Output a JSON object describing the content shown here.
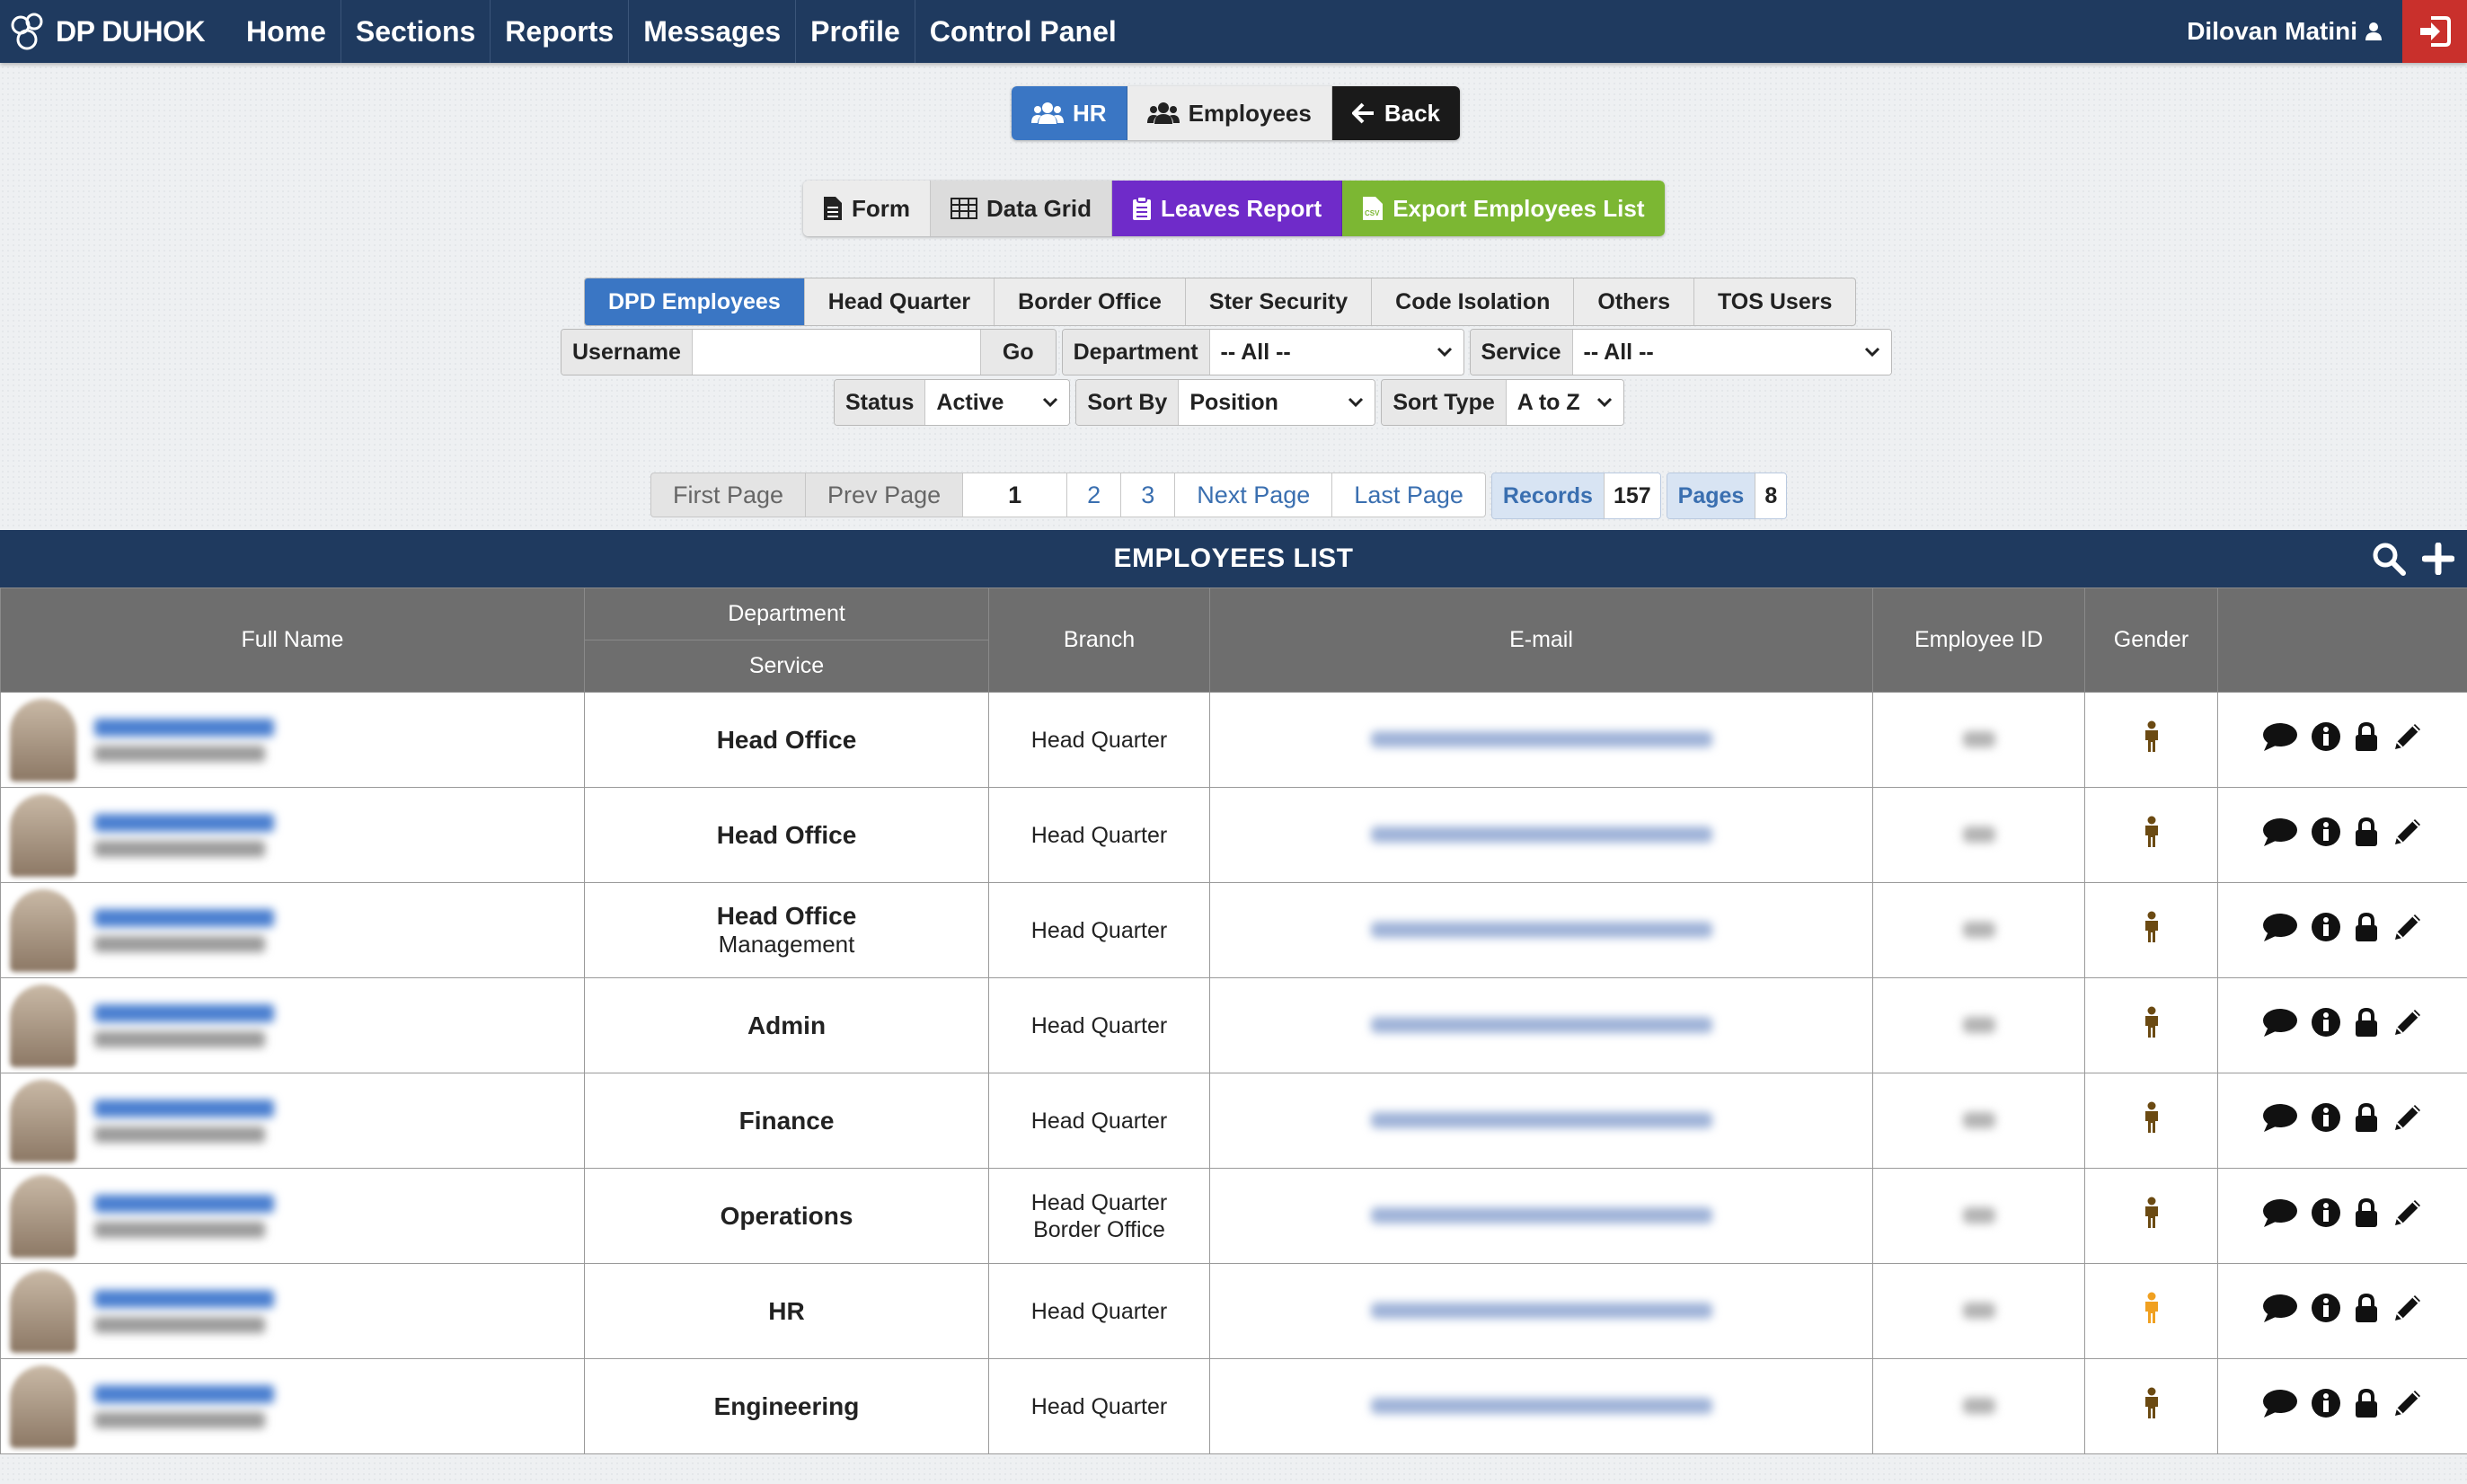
{
  "navbar": {
    "brand": "DP DUHOK",
    "items": [
      "Home",
      "Sections",
      "Reports",
      "Messages",
      "Profile",
      "Control Panel"
    ],
    "user": "Dilovan Matini"
  },
  "top_buttons": {
    "hr": "HR",
    "employees": "Employees",
    "back": "Back"
  },
  "view_buttons": {
    "form": "Form",
    "data_grid": "Data Grid",
    "leaves_report": "Leaves Report",
    "export": "Export Employees List"
  },
  "tabs": [
    "DPD Employees",
    "Head Quarter",
    "Border Office",
    "Ster Security",
    "Code Isolation",
    "Others",
    "TOS Users"
  ],
  "filters": {
    "username_label": "Username",
    "go": "Go",
    "department_label": "Department",
    "department_value": "-- All --",
    "service_label": "Service",
    "service_value": "-- All --",
    "status_label": "Status",
    "status_value": "Active",
    "sort_by_label": "Sort By",
    "sort_by_value": "Position",
    "sort_type_label": "Sort Type",
    "sort_type_value": "A to Z"
  },
  "pagination": {
    "first": "First Page",
    "prev": "Prev Page",
    "pages": [
      "1",
      "2",
      "3"
    ],
    "next": "Next Page",
    "last": "Last Page",
    "records_label": "Records",
    "records_value": "157",
    "pages_label": "Pages",
    "pages_value": "8"
  },
  "table": {
    "title": "EMPLOYEES LIST",
    "headers": {
      "full_name": "Full Name",
      "department": "Department",
      "service": "Service",
      "branch": "Branch",
      "email": "E-mail",
      "employee_id": "Employee ID",
      "gender": "Gender"
    },
    "rows": [
      {
        "department": "Head Office",
        "service": "",
        "branch": [
          "Head Quarter"
        ],
        "gender": "male"
      },
      {
        "department": "Head Office",
        "service": "",
        "branch": [
          "Head Quarter"
        ],
        "gender": "male"
      },
      {
        "department": "Head Office",
        "service": "Management",
        "branch": [
          "Head Quarter"
        ],
        "gender": "male"
      },
      {
        "department": "Admin",
        "service": "",
        "branch": [
          "Head Quarter"
        ],
        "gender": "male"
      },
      {
        "department": "Finance",
        "service": "",
        "branch": [
          "Head Quarter"
        ],
        "gender": "male"
      },
      {
        "department": "Operations",
        "service": "",
        "branch": [
          "Head Quarter",
          "Border Office"
        ],
        "gender": "male"
      },
      {
        "department": "HR",
        "service": "",
        "branch": [
          "Head Quarter"
        ],
        "gender": "female"
      },
      {
        "department": "Engineering",
        "service": "",
        "branch": [
          "Head Quarter"
        ],
        "gender": "male"
      }
    ]
  },
  "colors": {
    "navbar": "#1f3a5f",
    "primary": "#3a76c4",
    "purple": "#6f2bc9",
    "green": "#7cb733",
    "logout": "#c9302c",
    "male": "#6b4a12",
    "female": "#f0a020"
  },
  "icons": [
    "logo-icon",
    "user-icon",
    "logout-icon",
    "users-icon",
    "arrow-left-icon",
    "file-icon",
    "grid-icon",
    "clipboard-icon",
    "csv-icon",
    "search-icon",
    "plus-icon",
    "comment-icon",
    "info-icon",
    "lock-icon",
    "pencil-icon",
    "male-icon",
    "female-icon"
  ]
}
